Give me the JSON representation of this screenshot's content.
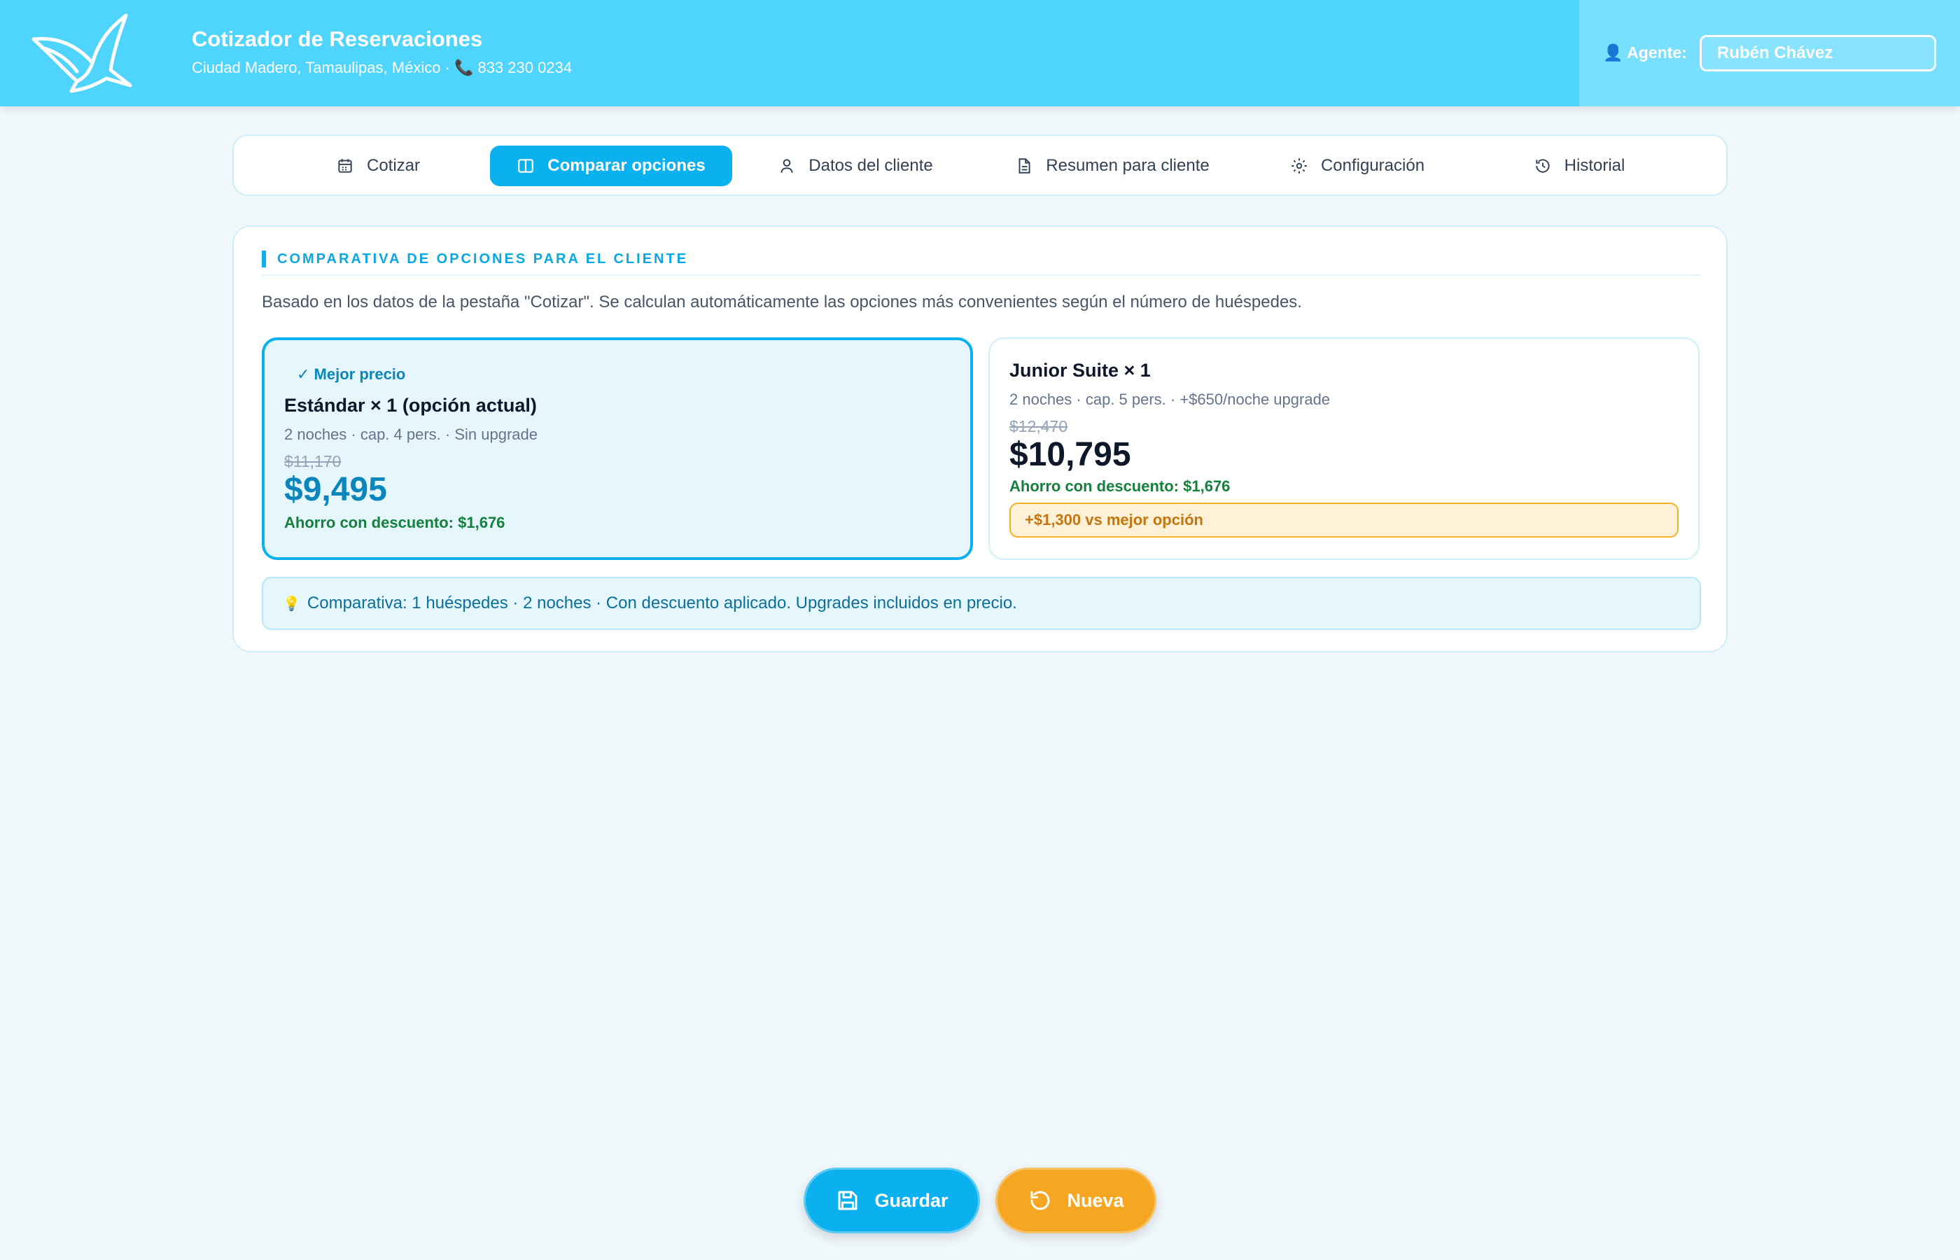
{
  "header": {
    "title": "Cotizador de Reservaciones",
    "subtitle": "Ciudad Madero, Tamaulipas, México · 📞 833 230 0234",
    "logo_icon": "seagull-logo-icon",
    "agent": {
      "label": "👤 Agente:",
      "value": "Rubén Chávez"
    }
  },
  "tabs": [
    {
      "label": "Cotizar",
      "icon": "calendar-icon",
      "active": false
    },
    {
      "label": "Comparar opciones",
      "icon": "columns-icon",
      "active": true
    },
    {
      "label": "Datos del cliente",
      "icon": "user-icon",
      "active": false
    },
    {
      "label": "Resumen para cliente",
      "icon": "document-icon",
      "active": false
    },
    {
      "label": "Configuración",
      "icon": "gear-icon",
      "active": false
    },
    {
      "label": "Historial",
      "icon": "history-icon",
      "active": false
    }
  ],
  "comparison": {
    "section_title": "COMPARATIVA DE OPCIONES PARA EL CLIENTE",
    "intro": "Basado en los datos de la pestaña \"Cotizar\". Se calculan automáticamente las opciones más convenientes según el número de huéspedes.",
    "options": [
      {
        "badge": "✓ Mejor precio",
        "name": "Estándar × 1 (opción actual)",
        "meta": "2 noches · cap. 4 pers. · Sin upgrade",
        "old_price": "$11,170",
        "price": "$9,495",
        "savings": "Ahorro con descuento: $1,676"
      },
      {
        "name": "Junior Suite × 1",
        "meta": "2 noches · cap. 5 pers. · +$650/noche upgrade",
        "old_price": "$12,470",
        "price": "$10,795",
        "savings": "Ahorro con descuento: $1,676",
        "difference": "+$1,300 vs mejor opción"
      }
    ],
    "note": "Comparativa: 1 huéspedes · 2 noches · Con descuento aplicado. Upgrades incluidos en precio."
  },
  "actions": {
    "save_label": "Guardar",
    "new_label": "Nueva"
  },
  "colors": {
    "header": "#4fd5fd",
    "accent": "#0bb1ef",
    "best_price": "#0a86bd",
    "savings": "#15803d",
    "warning": "#f5a622"
  }
}
